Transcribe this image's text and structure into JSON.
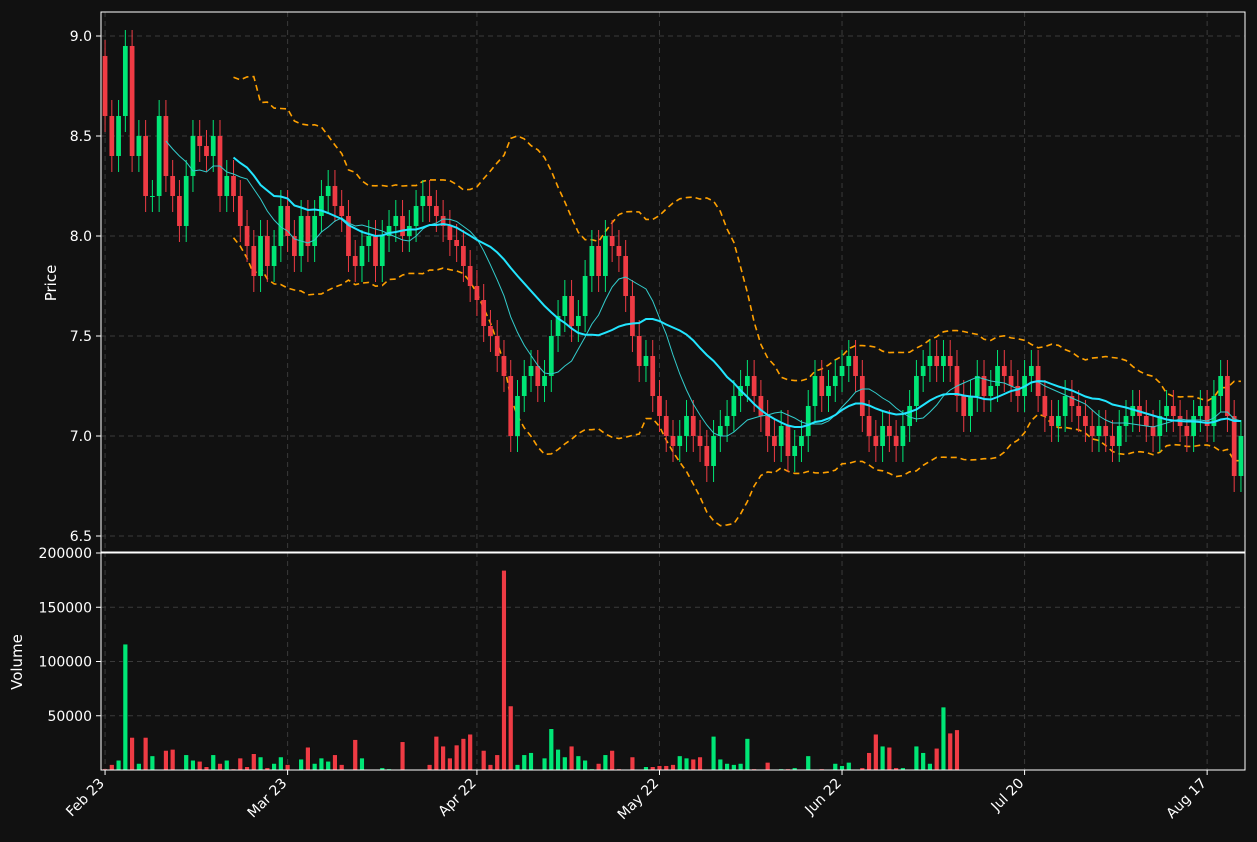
{
  "chart_data": {
    "type": "candlestick",
    "panels": [
      {
        "name": "price",
        "ylabel": "Price",
        "ylim": [
          6.42,
          9.12
        ],
        "yticks": [
          6.5,
          7.0,
          7.5,
          8.0,
          8.5,
          9.0
        ]
      },
      {
        "name": "volume",
        "ylabel": "Volume",
        "ylim": [
          0,
          200000
        ],
        "yticks": [
          50000,
          100000,
          150000,
          200000
        ]
      }
    ],
    "xlim": [
      -0.6,
      168.6
    ],
    "x_ticks": [
      {
        "index": 0,
        "label": "Feb 23"
      },
      {
        "index": 27,
        "label": "Mar 23"
      },
      {
        "index": 55,
        "label": "Apr 22"
      },
      {
        "index": 82,
        "label": "May 22"
      },
      {
        "index": 109,
        "label": "Jun 22"
      },
      {
        "index": 136,
        "label": "Jul 20"
      },
      {
        "index": 163,
        "label": "Aug 17"
      }
    ],
    "grid": true,
    "colors": {
      "background": "#111111",
      "up": "#00e676",
      "down": "#ef3b44",
      "ma_fast": "#33cccc",
      "ma_slow": "#22e5ff",
      "bands": "#ffa000",
      "grid": "#3a3a3a",
      "spine": "#ffffff"
    },
    "series_notes": {
      "candles": "approximate daily OHLC read from chart",
      "volume": "approximate, colored by candle direction"
    },
    "anchors": {
      "close": [
        [
          0,
          8.6
        ],
        [
          1,
          8.4
        ],
        [
          2,
          8.6
        ],
        [
          3,
          8.95
        ],
        [
          4,
          8.4
        ],
        [
          5,
          8.5
        ],
        [
          6,
          8.2
        ],
        [
          7,
          8.2
        ],
        [
          8,
          8.6
        ],
        [
          9,
          8.3
        ],
        [
          10,
          8.2
        ],
        [
          11,
          8.05
        ],
        [
          12,
          8.3
        ],
        [
          13,
          8.5
        ],
        [
          14,
          8.45
        ],
        [
          15,
          8.4
        ],
        [
          16,
          8.5
        ],
        [
          17,
          8.2
        ],
        [
          18,
          8.3
        ],
        [
          19,
          8.2
        ],
        [
          20,
          8.05
        ],
        [
          21,
          7.95
        ],
        [
          22,
          7.8
        ],
        [
          23,
          8.0
        ],
        [
          24,
          7.85
        ],
        [
          25,
          7.95
        ],
        [
          26,
          8.15
        ],
        [
          27,
          8.0
        ],
        [
          28,
          7.9
        ],
        [
          29,
          8.1
        ],
        [
          30,
          7.95
        ],
        [
          31,
          8.1
        ],
        [
          32,
          8.2
        ],
        [
          33,
          8.25
        ],
        [
          34,
          8.15
        ],
        [
          35,
          8.1
        ],
        [
          36,
          7.9
        ],
        [
          37,
          7.85
        ],
        [
          38,
          7.95
        ],
        [
          39,
          8.0
        ],
        [
          40,
          7.85
        ],
        [
          41,
          8.0
        ],
        [
          42,
          8.05
        ],
        [
          43,
          8.1
        ],
        [
          44,
          8.0
        ],
        [
          45,
          8.05
        ],
        [
          46,
          8.15
        ],
        [
          47,
          8.2
        ],
        [
          48,
          8.15
        ],
        [
          49,
          8.1
        ],
        [
          50,
          8.05
        ],
        [
          51,
          7.98
        ],
        [
          52,
          7.95
        ],
        [
          53,
          7.85
        ],
        [
          54,
          7.75
        ],
        [
          55,
          7.68
        ],
        [
          56,
          7.55
        ],
        [
          57,
          7.5
        ],
        [
          58,
          7.4
        ],
        [
          59,
          7.3
        ],
        [
          60,
          7.0
        ],
        [
          61,
          7.2
        ],
        [
          62,
          7.3
        ],
        [
          63,
          7.35
        ],
        [
          64,
          7.25
        ],
        [
          65,
          7.3
        ],
        [
          66,
          7.5
        ],
        [
          67,
          7.6
        ],
        [
          68,
          7.7
        ],
        [
          69,
          7.55
        ],
        [
          70,
          7.6
        ],
        [
          71,
          7.8
        ],
        [
          72,
          7.95
        ],
        [
          73,
          7.8
        ],
        [
          74,
          8.0
        ],
        [
          75,
          7.95
        ],
        [
          76,
          7.9
        ],
        [
          77,
          7.7
        ],
        [
          78,
          7.5
        ],
        [
          79,
          7.35
        ],
        [
          80,
          7.4
        ],
        [
          81,
          7.2
        ],
        [
          82,
          7.1
        ],
        [
          83,
          7.0
        ],
        [
          84,
          6.95
        ],
        [
          85,
          7.0
        ],
        [
          86,
          7.1
        ],
        [
          87,
          7.0
        ],
        [
          88,
          6.95
        ],
        [
          89,
          6.85
        ],
        [
          90,
          7.0
        ],
        [
          91,
          7.05
        ],
        [
          92,
          7.1
        ],
        [
          93,
          7.2
        ],
        [
          94,
          7.25
        ],
        [
          95,
          7.3
        ],
        [
          96,
          7.2
        ],
        [
          97,
          7.1
        ],
        [
          98,
          7.0
        ],
        [
          99,
          6.95
        ],
        [
          100,
          7.05
        ],
        [
          101,
          6.9
        ],
        [
          102,
          6.95
        ],
        [
          103,
          7.0
        ],
        [
          104,
          7.15
        ],
        [
          105,
          7.3
        ],
        [
          106,
          7.2
        ],
        [
          107,
          7.25
        ],
        [
          108,
          7.3
        ],
        [
          109,
          7.35
        ],
        [
          110,
          7.4
        ],
        [
          111,
          7.3
        ],
        [
          112,
          7.1
        ],
        [
          113,
          7.0
        ],
        [
          114,
          6.95
        ],
        [
          115,
          7.05
        ],
        [
          116,
          7.0
        ],
        [
          117,
          6.95
        ],
        [
          118,
          7.05
        ],
        [
          119,
          7.15
        ],
        [
          120,
          7.3
        ],
        [
          121,
          7.35
        ],
        [
          122,
          7.4
        ],
        [
          123,
          7.35
        ],
        [
          124,
          7.4
        ],
        [
          125,
          7.35
        ],
        [
          126,
          7.2
        ],
        [
          127,
          7.1
        ],
        [
          128,
          7.2
        ],
        [
          129,
          7.3
        ],
        [
          130,
          7.2
        ],
        [
          131,
          7.25
        ],
        [
          132,
          7.35
        ],
        [
          133,
          7.3
        ],
        [
          134,
          7.25
        ],
        [
          135,
          7.2
        ],
        [
          136,
          7.3
        ],
        [
          137,
          7.35
        ],
        [
          138,
          7.2
        ],
        [
          139,
          7.1
        ],
        [
          140,
          7.05
        ],
        [
          141,
          7.1
        ],
        [
          142,
          7.2
        ],
        [
          143,
          7.15
        ],
        [
          144,
          7.1
        ],
        [
          145,
          7.05
        ],
        [
          146,
          7.0
        ],
        [
          147,
          7.05
        ],
        [
          148,
          7.0
        ],
        [
          149,
          6.95
        ],
        [
          150,
          7.05
        ],
        [
          151,
          7.1
        ],
        [
          152,
          7.15
        ],
        [
          153,
          7.1
        ],
        [
          154,
          7.05
        ],
        [
          155,
          7.0
        ],
        [
          156,
          7.1
        ],
        [
          157,
          7.15
        ],
        [
          158,
          7.1
        ],
        [
          159,
          7.05
        ],
        [
          160,
          7.0
        ],
        [
          161,
          7.1
        ],
        [
          162,
          7.15
        ],
        [
          163,
          7.05
        ],
        [
          164,
          7.2
        ],
        [
          165,
          7.3
        ],
        [
          166,
          7.1
        ],
        [
          167,
          6.8
        ],
        [
          168,
          7.0
        ]
      ],
      "volume": [
        [
          0,
          1000
        ],
        [
          1,
          5000
        ],
        [
          2,
          9000
        ],
        [
          3,
          116000
        ],
        [
          4,
          30000
        ],
        [
          5,
          6000
        ],
        [
          6,
          30000
        ],
        [
          7,
          13000
        ],
        [
          8,
          0
        ],
        [
          9,
          18000
        ],
        [
          10,
          19000
        ],
        [
          11,
          0
        ],
        [
          12,
          14000
        ],
        [
          13,
          9000
        ],
        [
          14,
          8000
        ],
        [
          15,
          3000
        ],
        [
          16,
          14000
        ],
        [
          17,
          6000
        ],
        [
          18,
          9000
        ],
        [
          19,
          1000
        ],
        [
          20,
          11000
        ],
        [
          21,
          3000
        ],
        [
          22,
          15000
        ],
        [
          23,
          12000
        ],
        [
          24,
          2000
        ],
        [
          25,
          6000
        ],
        [
          26,
          12000
        ],
        [
          27,
          5000
        ],
        [
          28,
          0
        ],
        [
          29,
          10000
        ],
        [
          30,
          21000
        ],
        [
          31,
          6000
        ],
        [
          32,
          11000
        ],
        [
          33,
          8000
        ],
        [
          34,
          14000
        ],
        [
          35,
          5000
        ],
        [
          36,
          0
        ],
        [
          37,
          28000
        ],
        [
          38,
          11000
        ],
        [
          39,
          0
        ],
        [
          40,
          0
        ],
        [
          41,
          2000
        ],
        [
          42,
          1000
        ],
        [
          43,
          0
        ],
        [
          44,
          26000
        ],
        [
          45,
          0
        ],
        [
          46,
          0
        ],
        [
          47,
          0
        ],
        [
          48,
          5000
        ],
        [
          49,
          31000
        ],
        [
          50,
          22000
        ],
        [
          51,
          11000
        ],
        [
          52,
          23000
        ],
        [
          53,
          29000
        ],
        [
          54,
          33000
        ],
        [
          55,
          0
        ],
        [
          56,
          18000
        ],
        [
          57,
          5000
        ],
        [
          58,
          14000
        ],
        [
          59,
          184000
        ],
        [
          60,
          59000
        ],
        [
          61,
          5000
        ],
        [
          62,
          14000
        ],
        [
          63,
          16000
        ],
        [
          64,
          0
        ],
        [
          65,
          11000
        ],
        [
          66,
          38000
        ],
        [
          67,
          19000
        ],
        [
          68,
          12000
        ],
        [
          69,
          22000
        ],
        [
          70,
          13000
        ],
        [
          71,
          9000
        ],
        [
          72,
          1000
        ],
        [
          73,
          6000
        ],
        [
          74,
          14000
        ],
        [
          75,
          18000
        ],
        [
          76,
          1000
        ],
        [
          77,
          0
        ],
        [
          78,
          12000
        ],
        [
          79,
          0
        ],
        [
          80,
          3000
        ],
        [
          81,
          3000
        ],
        [
          82,
          4000
        ],
        [
          83,
          4000
        ],
        [
          84,
          5000
        ],
        [
          85,
          13000
        ],
        [
          86,
          11000
        ],
        [
          87,
          10000
        ],
        [
          88,
          12000
        ],
        [
          89,
          0
        ],
        [
          90,
          31000
        ],
        [
          91,
          10000
        ],
        [
          92,
          6000
        ],
        [
          93,
          5000
        ],
        [
          94,
          6000
        ],
        [
          95,
          29000
        ],
        [
          96,
          1000
        ],
        [
          97,
          0
        ],
        [
          98,
          7000
        ],
        [
          99,
          0
        ],
        [
          100,
          1000
        ],
        [
          101,
          1000
        ],
        [
          102,
          2000
        ],
        [
          103,
          0
        ],
        [
          104,
          13000
        ],
        [
          105,
          0
        ],
        [
          106,
          1000
        ],
        [
          107,
          0
        ],
        [
          108,
          6000
        ],
        [
          109,
          4000
        ],
        [
          110,
          7000
        ],
        [
          111,
          0
        ],
        [
          112,
          2000
        ],
        [
          113,
          16000
        ],
        [
          114,
          33000
        ],
        [
          115,
          22000
        ],
        [
          116,
          21000
        ],
        [
          117,
          2000
        ],
        [
          118,
          2000
        ],
        [
          119,
          0
        ],
        [
          120,
          22000
        ],
        [
          121,
          16000
        ],
        [
          122,
          6000
        ],
        [
          123,
          20000
        ],
        [
          124,
          58000
        ],
        [
          125,
          34000
        ],
        [
          126,
          37000
        ],
        [
          127,
          0
        ],
        [
          128,
          0
        ],
        [
          129,
          0
        ],
        [
          130,
          0
        ],
        [
          131,
          0
        ],
        [
          132,
          0
        ],
        [
          133,
          0
        ],
        [
          134,
          0
        ],
        [
          135,
          0
        ],
        [
          136,
          0
        ],
        [
          137,
          0
        ],
        [
          138,
          0
        ],
        [
          139,
          0
        ],
        [
          140,
          0
        ],
        [
          141,
          0
        ],
        [
          142,
          0
        ],
        [
          143,
          0
        ],
        [
          144,
          0
        ],
        [
          145,
          0
        ],
        [
          146,
          0
        ],
        [
          147,
          0
        ],
        [
          148,
          0
        ],
        [
          149,
          0
        ],
        [
          150,
          0
        ],
        [
          151,
          0
        ],
        [
          152,
          0
        ],
        [
          153,
          0
        ],
        [
          154,
          0
        ],
        [
          155,
          0
        ],
        [
          156,
          0
        ],
        [
          157,
          0
        ],
        [
          158,
          0
        ],
        [
          159,
          0
        ],
        [
          160,
          0
        ],
        [
          161,
          0
        ],
        [
          162,
          0
        ],
        [
          163,
          0
        ],
        [
          164,
          0
        ],
        [
          165,
          0
        ],
        [
          166,
          0
        ],
        [
          167,
          0
        ],
        [
          168,
          0
        ]
      ]
    }
  }
}
